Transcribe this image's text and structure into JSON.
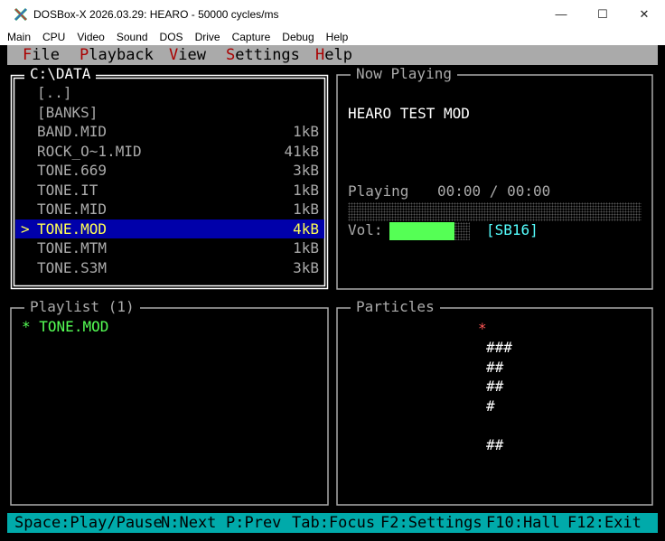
{
  "window": {
    "title": "DOSBox-X 2026.03.29: HEARO - 50000 cycles/ms",
    "minimize": "—",
    "maximize": "☐",
    "close": "✕"
  },
  "host_menu": [
    "Main",
    "CPU",
    "Video",
    "Sound",
    "DOS",
    "Drive",
    "Capture",
    "Debug",
    "Help"
  ],
  "app_menu": [
    {
      "hot": "F",
      "rest": "ile"
    },
    {
      "hot": "P",
      "rest": "layback"
    },
    {
      "hot": "V",
      "rest": "iew"
    },
    {
      "hot": "S",
      "rest": "ettings"
    },
    {
      "hot": "H",
      "rest": "elp"
    }
  ],
  "browser": {
    "title": "C:\\DATA",
    "cursor": ">",
    "items": [
      {
        "name": "[..]",
        "size": ""
      },
      {
        "name": "[BANKS]",
        "size": ""
      },
      {
        "name": "BAND.MID",
        "size": "1kB"
      },
      {
        "name": "ROCK_O~1.MID",
        "size": "41kB"
      },
      {
        "name": "TONE.669",
        "size": "3kB"
      },
      {
        "name": "TONE.IT",
        "size": "1kB"
      },
      {
        "name": "TONE.MID",
        "size": "1kB"
      },
      {
        "name": "TONE.MOD",
        "size": "4kB"
      },
      {
        "name": "TONE.MTM",
        "size": "1kB"
      },
      {
        "name": "TONE.S3M",
        "size": "3kB"
      }
    ],
    "selected_index": 7
  },
  "now_playing": {
    "title": "Now Playing",
    "song": "HEARO TEST MOD",
    "status": "Playing",
    "time": "00:00 / 00:00",
    "progress": 0,
    "volume_label": "Vol:",
    "volume": 0.81,
    "device": "[SB16]"
  },
  "playlist": {
    "title": "Playlist (1)",
    "items": [
      {
        "marker": "*",
        "name": "TONE.MOD"
      }
    ]
  },
  "particles": {
    "title": "Particles",
    "star": "*",
    "rows": [
      "###",
      "##",
      "##",
      "#",
      "",
      "##"
    ]
  },
  "status_bar": [
    "Space:Play/Pause",
    "N:Next",
    "P:Prev",
    "Tab:Focus",
    "F2:Settings",
    "F10:Hall",
    "F12:Exit"
  ],
  "colors": {
    "selection_bg": "#0000aa",
    "selection_fg": "#ffff55",
    "volume_fill": "#55ff55",
    "device": "#55ffff",
    "status_bg": "#00aaaa",
    "menu_hotkey": "#aa0000",
    "particle_star": "#ff5555"
  }
}
